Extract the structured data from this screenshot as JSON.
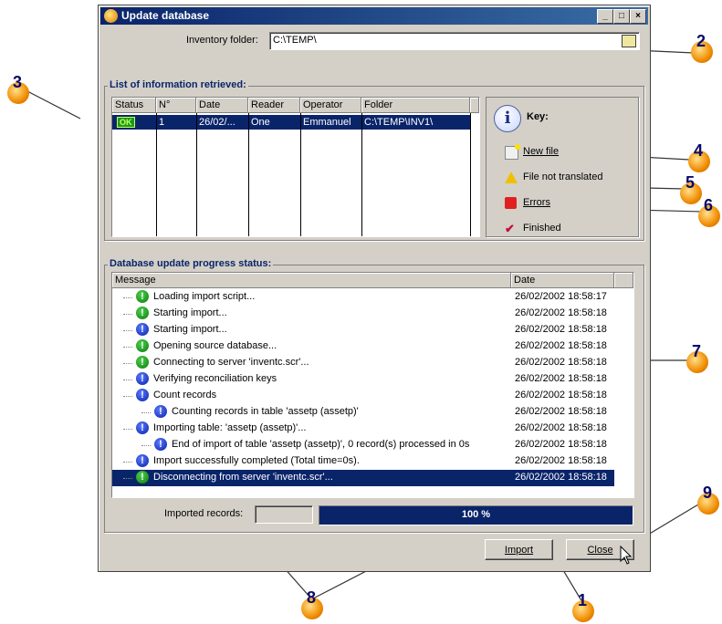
{
  "window": {
    "title": "Update database",
    "min_btn": "_",
    "max_btn": "□",
    "close_btn": "×"
  },
  "inventory": {
    "label": "Inventory folder:",
    "value": "C:\\TEMP\\",
    "browse_icon": "folder-icon"
  },
  "list_group": {
    "title": "List of information retrieved:",
    "columns": [
      "Status",
      "N°",
      "Date",
      "Reader",
      "Operator",
      "Folder"
    ],
    "rows": [
      {
        "status": "OK",
        "num": "1",
        "date": "26/02/...",
        "reader": "One",
        "operator": "Emmanuel",
        "folder": "C:\\TEMP\\INV1\\"
      }
    ]
  },
  "key": {
    "title": "Key:",
    "items": [
      {
        "label": "New file",
        "icon": "new-file-icon"
      },
      {
        "label": "File not translated",
        "icon": "warning-icon"
      },
      {
        "label": "Errors",
        "icon": "errors-icon"
      },
      {
        "label": "Finished",
        "icon": "finished-icon"
      }
    ]
  },
  "progress_group": {
    "title": "Database update progress status:",
    "columns": [
      "Message",
      "Date"
    ],
    "messages": [
      {
        "text": "Loading import script...",
        "date": "26/02/2002 18:58:17",
        "icon": "green",
        "indent": 1
      },
      {
        "text": "Starting import...",
        "date": "26/02/2002 18:58:18",
        "icon": "green",
        "indent": 1
      },
      {
        "text": "Starting import...",
        "date": "26/02/2002 18:58:18",
        "icon": "blue",
        "indent": 1
      },
      {
        "text": "Opening source database...",
        "date": "26/02/2002 18:58:18",
        "icon": "green",
        "indent": 1
      },
      {
        "text": "Connecting to server 'inventc.scr'...",
        "date": "26/02/2002 18:58:18",
        "icon": "green",
        "indent": 1
      },
      {
        "text": "Verifying reconciliation keys",
        "date": "26/02/2002 18:58:18",
        "icon": "blue",
        "indent": 1
      },
      {
        "text": "Count records",
        "date": "26/02/2002 18:58:18",
        "icon": "blue",
        "indent": 1
      },
      {
        "text": "Counting records in table 'assetp (assetp)'",
        "date": "26/02/2002 18:58:18",
        "icon": "blue",
        "indent": 2
      },
      {
        "text": "Importing table: 'assetp (assetp)'...",
        "date": "26/02/2002 18:58:18",
        "icon": "blue",
        "indent": 1
      },
      {
        "text": "End of import of table 'assetp (assetp)', 0 record(s) processed in 0s",
        "date": "26/02/2002 18:58:18",
        "icon": "blue",
        "indent": 2
      },
      {
        "text": "Import successfully completed (Total time=0s).",
        "date": "26/02/2002 18:58:18",
        "icon": "blue",
        "indent": 1
      },
      {
        "text": "Disconnecting from server 'inventc.scr'...",
        "date": "26/02/2002 18:58:18",
        "icon": "green",
        "indent": 1,
        "selected": true
      }
    ]
  },
  "imported_records": {
    "label": "Imported records:",
    "value": ""
  },
  "progress": {
    "text": "100 %",
    "fraction": 1.0
  },
  "buttons": {
    "import": "Import",
    "close": "Close"
  },
  "markers": [
    "1",
    "2",
    "3",
    "4",
    "5",
    "6",
    "7",
    "8",
    "9"
  ]
}
